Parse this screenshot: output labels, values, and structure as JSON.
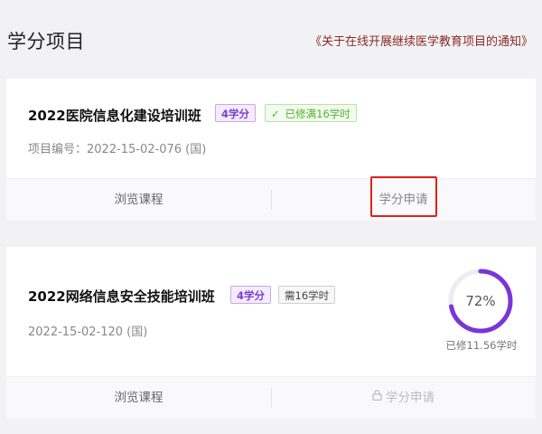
{
  "header": {
    "title": "学分项目",
    "notice_link": "《关于在线开展继续医学教育项目的通知》"
  },
  "courses": [
    {
      "title": "2022医院信息化建设培训班",
      "credit_badge": "4学分",
      "status_badge": "已修满16学时",
      "project_code": "项目编号：2022-15-02-076 (国)",
      "browse_label": "浏览课程",
      "apply_label": "学分申请",
      "apply_enabled": true
    },
    {
      "title": "2022网络信息安全技能培训班",
      "credit_badge": "4学分",
      "status_badge": "需16学时",
      "project_code": "2022-15-02-120 (国)",
      "browse_label": "浏览课程",
      "apply_label": "学分申请",
      "apply_enabled": false,
      "progress": {
        "percent": 72,
        "percent_label": "72%",
        "caption": "已修11.56学时"
      }
    }
  ],
  "colors": {
    "accent_purple": "#7a3fd0",
    "progress_ring": "#7b35d6",
    "done_green": "#52b130",
    "notice_red": "#8b2a24",
    "highlight_red": "#e0201a"
  },
  "icons": {
    "status_done": "check-icon",
    "apply_locked": "lock-icon"
  }
}
